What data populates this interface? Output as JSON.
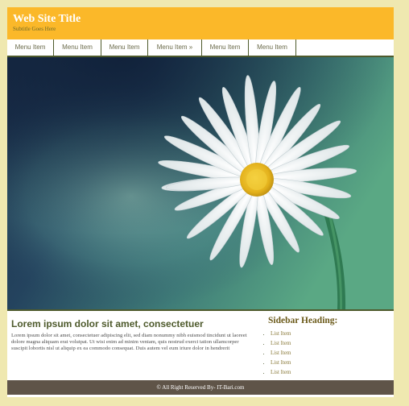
{
  "header": {
    "title": "Web Site Title",
    "subtitle": "Subtitle Goes Here"
  },
  "nav": {
    "items": [
      {
        "label": "Menu Item"
      },
      {
        "label": "Menu Item"
      },
      {
        "label": "Menu Item"
      },
      {
        "label": "Menu Item »"
      },
      {
        "label": "Menu Item"
      },
      {
        "label": "Menu Item"
      }
    ]
  },
  "hero": {
    "image": "daisy-flower-photo"
  },
  "main": {
    "heading": "Lorem ipsum dolor sit amet, consectetuer",
    "body": "Lorem ipsum dolor sit amet, consectetuer adipiscing elit, sed diam nonummy nibh euismod tincidunt ut laoreet dolore magna aliquam erat volutpat. Ut wisi enim ad minim veniam, quis nostrud exerci tation ullamcorper suscipit lobortis nisl ut aliquip ex ea commodo consequat. Duis autem vel eum iriure dolor in hendrerit"
  },
  "sidebar": {
    "heading": "Sidebar Heading:",
    "items": [
      {
        "label": "List Item"
      },
      {
        "label": "List Item"
      },
      {
        "label": "List Item"
      },
      {
        "label": "List Item"
      },
      {
        "label": "List Item"
      }
    ]
  },
  "footer": {
    "text": "© All Right Reserved By- IT-Bari.com"
  },
  "colors": {
    "page_background": "#efe8b0",
    "header": "#fbb829",
    "rule": "#4e5a2c",
    "footer": "#5f5448"
  }
}
